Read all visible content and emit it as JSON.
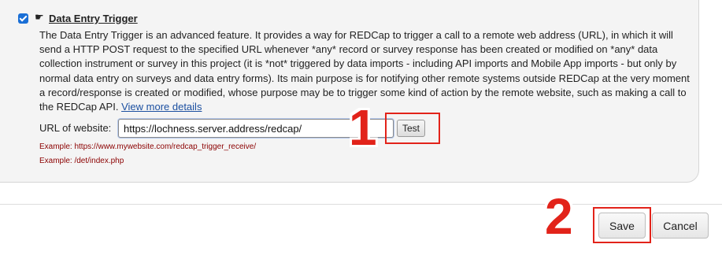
{
  "trigger": {
    "checked": true,
    "icon": "pointing-hand-icon",
    "title": "Data Entry Trigger",
    "description_text": "The Data Entry Trigger is an advanced feature. It provides a way for REDCap to trigger a call to a remote web address (URL), in which it will send a HTTP POST request to the specified URL whenever *any* record or survey response has been created or modified on *any* data collection instrument or survey in this project (it is *not* triggered by data imports - including API imports and Mobile App imports - but only by normal data entry on surveys and data entry forms). Its main purpose is for notifying other remote systems outside REDCap at the very moment a record/response is created or modified, whose purpose may be to trigger some kind of action by the remote website, such as making a call to the REDCap API.",
    "more_details_link": "View more details"
  },
  "url_field": {
    "label": "URL of website:",
    "value": "https://lochness.server.address/redcap/",
    "test_button": "Test"
  },
  "examples": [
    "Example: https://www.mywebsite.com/redcap_trigger_receive/",
    "Example: /det/index.php"
  ],
  "footer": {
    "save_button": "Save",
    "cancel_button": "Cancel"
  },
  "annotations": {
    "marker_1": "1",
    "marker_2": "2",
    "color": "#e2231a"
  }
}
